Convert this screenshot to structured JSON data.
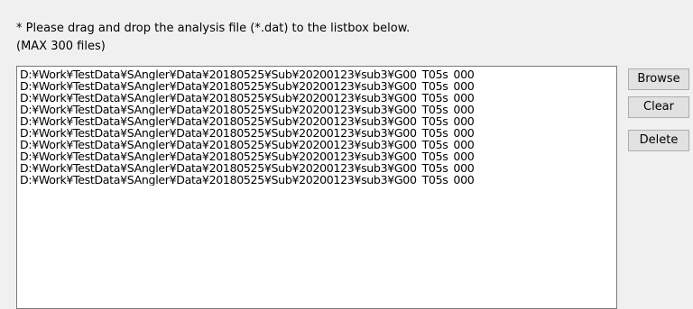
{
  "instruction": {
    "line1": "* Please drag and drop the analysis file (*.dat) to the listbox below.",
    "line2": "(MAX 300 files)"
  },
  "listbox": {
    "files": [
      "D:¥Work¥TestData¥SAngler¥Data¥20180525¥Sub¥20200123¥sub3¥G00_T05s_000",
      "D:¥Work¥TestData¥SAngler¥Data¥20180525¥Sub¥20200123¥sub3¥G00_T05s_000",
      "D:¥Work¥TestData¥SAngler¥Data¥20180525¥Sub¥20200123¥sub3¥G00_T05s_000",
      "D:¥Work¥TestData¥SAngler¥Data¥20180525¥Sub¥20200123¥sub3¥G00_T05s_000",
      "D:¥Work¥TestData¥SAngler¥Data¥20180525¥Sub¥20200123¥sub3¥G00_T05s_000",
      "D:¥Work¥TestData¥SAngler¥Data¥20180525¥Sub¥20200123¥sub3¥G00_T05s_000",
      "D:¥Work¥TestData¥SAngler¥Data¥20180525¥Sub¥20200123¥sub3¥G00_T05s_000",
      "D:¥Work¥TestData¥SAngler¥Data¥20180525¥Sub¥20200123¥sub3¥G00_T05s_000",
      "D:¥Work¥TestData¥SAngler¥Data¥20180525¥Sub¥20200123¥sub3¥G00_T05s_000",
      "D:¥Work¥TestData¥SAngler¥Data¥20180525¥Sub¥20200123¥sub3¥G00_T05s_000"
    ]
  },
  "buttons": {
    "browse": "Browse",
    "clear": "Clear",
    "delete": "Delete"
  }
}
